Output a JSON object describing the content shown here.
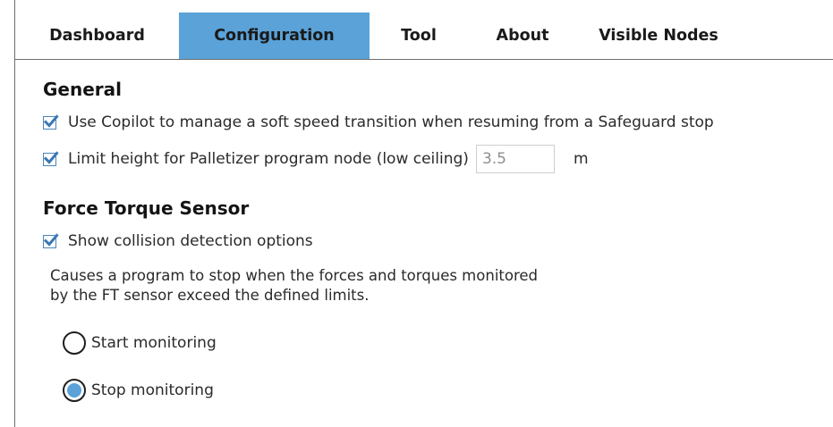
{
  "tabs": [
    {
      "label": "Dashboard",
      "active": false
    },
    {
      "label": "Configuration",
      "active": true
    },
    {
      "label": "Tool",
      "active": false
    },
    {
      "label": "About",
      "active": false
    },
    {
      "label": "Visible Nodes",
      "active": false
    }
  ],
  "general": {
    "title": "General",
    "copilot_option": {
      "label": "Use Copilot to manage a soft speed transition when resuming from a Safeguard stop",
      "checked": true
    },
    "limit_height_option": {
      "label": "Limit height for Palletizer program node (low ceiling)",
      "checked": true
    },
    "height_value": "3.5",
    "height_unit": "m"
  },
  "force_torque": {
    "title": "Force Torque Sensor",
    "collision_option": {
      "label": "Show collision detection options",
      "checked": true
    },
    "description_line1": "Causes a program to stop when the forces and torques monitored",
    "description_line2": "by the FT sensor exceed the defined limits.",
    "radio_start": {
      "label": "Start monitoring",
      "selected": false
    },
    "radio_stop": {
      "label": "Stop monitoring",
      "selected": true
    }
  },
  "colors": {
    "accent": "#5aa2d8",
    "check_mark": "#3b78b5"
  }
}
